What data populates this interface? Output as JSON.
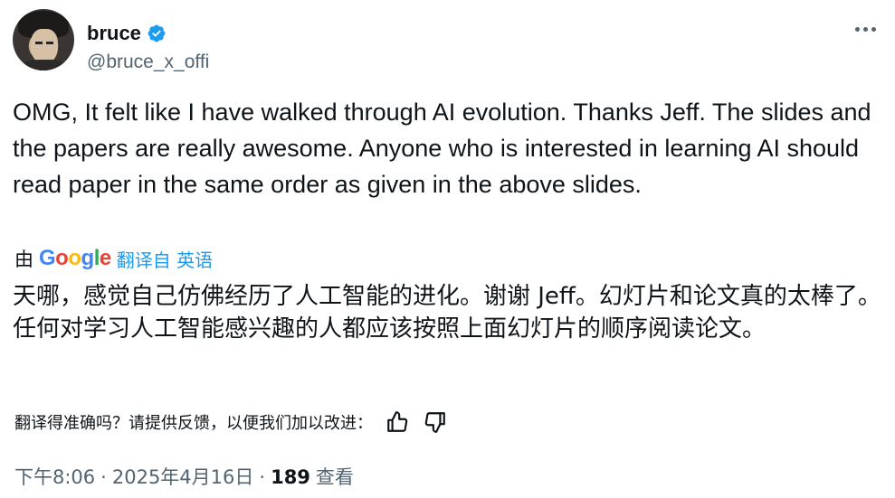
{
  "author": {
    "display_name": "bruce",
    "handle": "@bruce_x_offi",
    "verified_icon": "verified-badge-icon",
    "more_icon": "more-options-icon"
  },
  "tweet": {
    "text": "OMG, It felt like I have walked through AI evolution. Thanks Jeff. The slides and the papers are really awesome. Anyone who is interested in learning AI should read paper in the same order as given in the above slides."
  },
  "translation": {
    "by_label": "由",
    "google_logo": [
      "G",
      "o",
      "o",
      "g",
      "l",
      "e"
    ],
    "from_label": "翻译自 英语",
    "text": "天哪，感觉自己仿佛经历了人工智能的进化。谢谢 Jeff。幻灯片和论文真的太棒了。任何对学习人工智能感兴趣的人都应该按照上面幻灯片的顺序阅读论文。"
  },
  "feedback": {
    "prompt": "翻译得准确吗？请提供反馈，以便我们加以改进：",
    "thumbs_up_icon": "thumbs-up-icon",
    "thumbs_down_icon": "thumbs-down-icon"
  },
  "meta": {
    "time": "下午8:06",
    "separator": "·",
    "date": "2025年4月16日",
    "views_count": "189",
    "views_label": "查看"
  },
  "colors": {
    "text": "#0f1419",
    "secondary": "#536471",
    "link": "#1d9bf0",
    "verified": "#1d9bf0"
  }
}
